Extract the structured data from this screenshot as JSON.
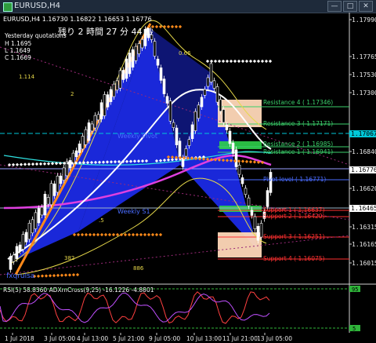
{
  "window": {
    "title": "EURUSD,H4",
    "min": "—",
    "max": "□",
    "close": "✕"
  },
  "chart": {
    "ohlc_header": "EURUSD,H4  1.16730 1.16822 1.16653 1.16776",
    "countdown": "残り 2 時間 27 分 44 秒",
    "yesterday_label": "Yesterday quotations",
    "H": "H 1.1695",
    "L": "L 1.1649",
    "C": "C 1.1669",
    "left_labels": {
      "l1": "1.114",
      "l2": "2",
      "l3": ".5",
      "l4": "382",
      "l5": "886",
      "l6": "0.66"
    },
    "fib_label": "0.66",
    "watermark": "fxqrulsa",
    "weekly_pivot": "Weekly Pivot",
    "weekly_s1": "Weekly S1",
    "levels": [
      {
        "label": "Resistance 4 ( 1.17346)",
        "color": "#3bd16b"
      },
      {
        "label": "Resistance 3 ( 1.17171)",
        "color": "#3bd16b"
      },
      {
        "label": "Resistance 2 ( 1.16985)",
        "color": "#3bd16b"
      },
      {
        "label": "Resistance 1 ( 1.16941)",
        "color": "#3bd16b"
      },
      {
        "label": "Pivot level ( 1.16771)",
        "color": "#4a6cff"
      },
      {
        "label": "Support 1 ( 1.16637)",
        "color": "#ff3030"
      },
      {
        "label": "Support 2 ( 1.16420)",
        "color": "#ff3030"
      },
      {
        "label": "Support 3 ( 1.16251)",
        "color": "#ff3030"
      },
      {
        "label": "Support 4 ( 1.16075)",
        "color": "#ff3030"
      }
    ],
    "price_axis": [
      "1.17990",
      "1.17765",
      "1.17530",
      "1.17300",
      "1.17067",
      "1.16840",
      "1.16776",
      "1.16620",
      "1.16465",
      "1.16315",
      "1.16165",
      "1.16015"
    ],
    "price_current": "1.16776",
    "price_cyan": "1.17067",
    "price_white": "1.16465",
    "time_axis": [
      "1 Jul 2018",
      "3 Jul 05:00",
      "4 Jul 13:00",
      "5 Jul 21:00",
      "9 Jul 05:00",
      "10 Jul 13:00",
      "11 Jul 21:00",
      "13 Jul 05:00"
    ]
  },
  "indicator": {
    "label": "RSI(5) 58.8360  ADXmCross(9,25) -16.1226 -4.8801",
    "level_top": "95",
    "level_bottom": "5"
  }
}
